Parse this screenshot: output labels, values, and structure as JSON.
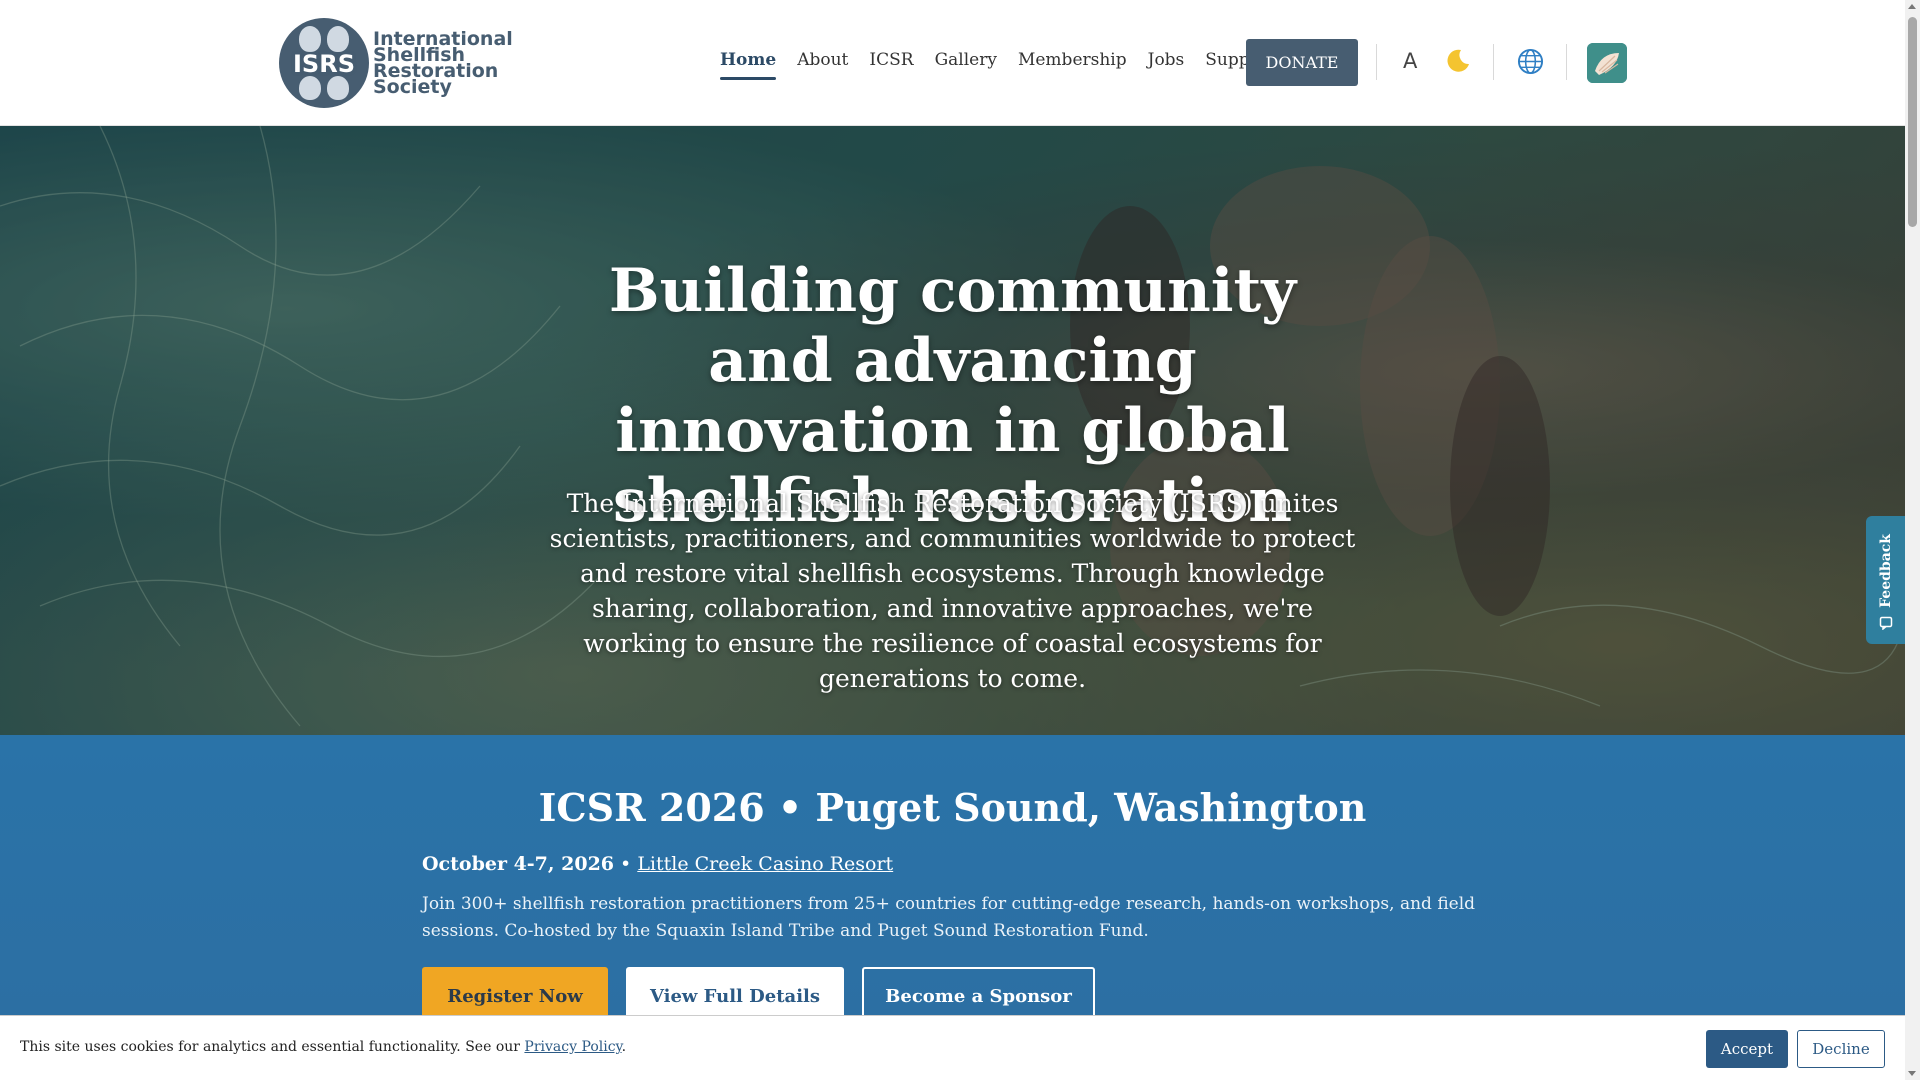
{
  "logo": {
    "acronym": "ISRS",
    "name_line1": "International",
    "name_line2": "Shellfish",
    "name_line3": "Restoration",
    "name_line4": "Society"
  },
  "nav": {
    "items": [
      {
        "label": "Home",
        "active": true
      },
      {
        "label": "About"
      },
      {
        "label": "ICSR"
      },
      {
        "label": "Gallery"
      },
      {
        "label": "Membership"
      },
      {
        "label": "Jobs"
      },
      {
        "label": "Support"
      }
    ],
    "donate_label": "DONATE",
    "font_icon_label": "A"
  },
  "hero": {
    "title": "Building community and advancing innovation in global shellfish restoration",
    "subtitle": "The International Shellfish Restoration Society (ISRS) unites scientists, practitioners, and communities worldwide to protect and restore vital shellfish ecosystems. Through knowledge sharing, collaboration, and innovative approaches, we're working to ensure the resilience of coastal ecosystems for generations to come."
  },
  "feedback": {
    "label": "Feedback"
  },
  "conference": {
    "title": "ICSR 2026 • Puget Sound, Washington",
    "dates": "October 4-7, 2026",
    "separator": " • ",
    "venue": "Little Creek Casino Resort",
    "description": "Join 300+ shellfish restoration practitioners from 25+ countries for cutting-edge research, hands-on workshops, and field sessions. Co-hosted by the Squaxin Island Tribe and Puget Sound Restoration Fund.",
    "register_label": "Register Now",
    "details_label": "View Full Details",
    "sponsor_label": "Become a Sponsor"
  },
  "cookie": {
    "text": "This site uses cookies for analytics and essential functionality. See our ",
    "policy_link": "Privacy Policy",
    "period": ".",
    "accept_label": "Accept",
    "decline_label": "Decline"
  },
  "colors": {
    "brand": "#475d71",
    "nav_active": "#2c4a66",
    "conference_bg": "#2a73a8",
    "register_btn": "#f0a623",
    "feedback_tab": "#2f7f9e"
  }
}
